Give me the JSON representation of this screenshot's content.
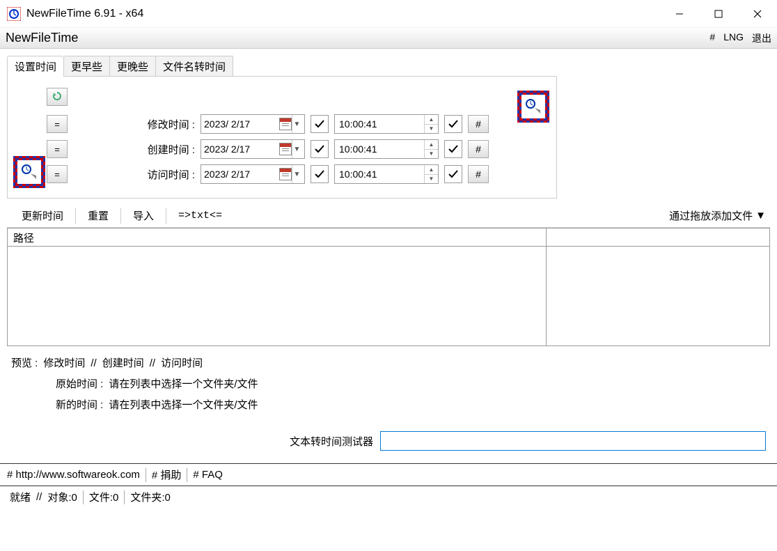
{
  "titlebar": {
    "title": "NewFileTime 6.91 - x64"
  },
  "menubar": {
    "app_name": "NewFileTime",
    "right": {
      "hash": "#",
      "lng": "LNG",
      "exit": "退出"
    }
  },
  "tabs": {
    "set_time": "设置时间",
    "earlier": "更早些",
    "later": "更晚些",
    "filename_to_time": "文件名转时间"
  },
  "rows": {
    "modify": {
      "label": "修改时间 :",
      "date": "2023/ 2/17",
      "time": "10:00:41"
    },
    "create": {
      "label": "创建时间 :",
      "date": "2023/ 2/17",
      "time": "10:00:41"
    },
    "access": {
      "label": "访问时间 :",
      "date": "2023/ 2/17",
      "time": "10:00:41"
    }
  },
  "hash": "#",
  "eq": "=",
  "toolbar2": {
    "update": "更新时间",
    "reset": "重置",
    "import": "导入",
    "txt": "=>txt<=",
    "hint": "通过拖放添加文件"
  },
  "filelist": {
    "col_path": "路径"
  },
  "preview": {
    "header_prefix": "预览 :",
    "modify": "修改时间",
    "create": "创建时间",
    "access": "访问时间",
    "sep": "//",
    "original_label": "原始时间 :",
    "new_label": "新的时间 :",
    "placeholder": "请在列表中选择一个文件夹/文件"
  },
  "tester": {
    "label": "文本转时间测试器"
  },
  "linkbar": {
    "url": "# http://www.softwareok.com",
    "donate": "# 捐助",
    "faq": "# FAQ"
  },
  "statusbar": {
    "ready": "就绪",
    "objects": "对象:0",
    "files": "文件:0",
    "folders": "文件夹:0",
    "sep": "//"
  }
}
